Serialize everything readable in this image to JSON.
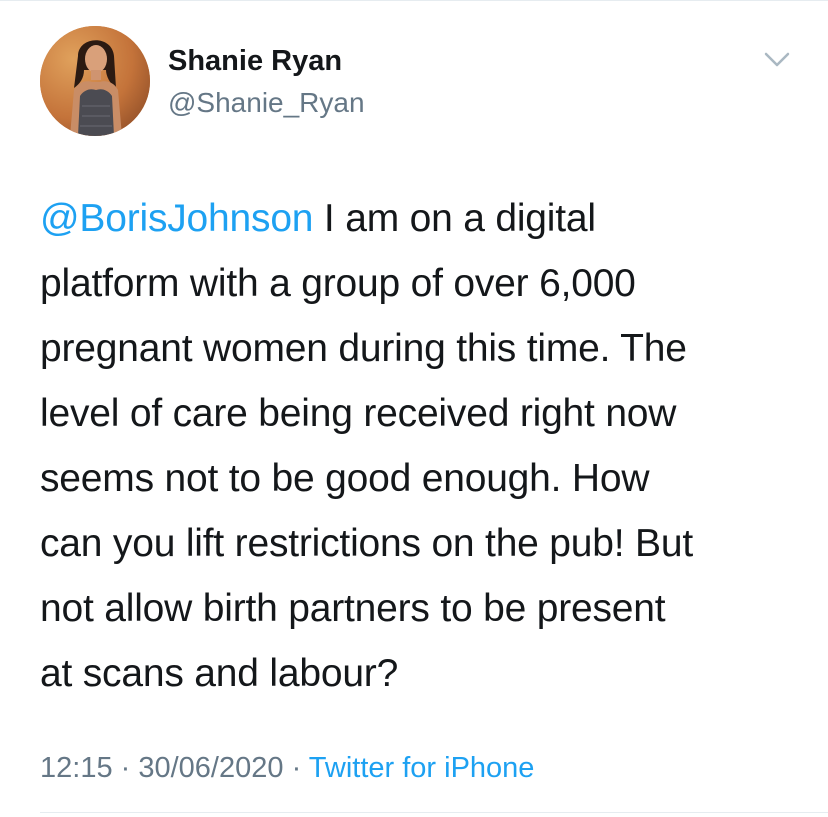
{
  "tweet": {
    "author_name": "Shanie Ryan",
    "author_handle": "@Shanie_Ryan",
    "mention": "@BorisJohnson",
    "body": " I am on a digital\nplatform with a group of over 6,000\npregnant women during this time. The\nlevel of care being received right now\nseems not to be good enough. How\ncan you lift restrictions on the pub! But\nnot allow birth partners to be present\nat scans and labour?",
    "time": "12:15",
    "date": "30/06/2020",
    "separator": " · ",
    "source": "Twitter for iPhone"
  },
  "icons": {
    "menu": "chevron-down-icon",
    "avatar": "profile-photo"
  },
  "colors": {
    "link": "#1da1f2",
    "secondary_text": "#657786",
    "primary_text": "#14171a",
    "divider": "#e6ecf0"
  }
}
